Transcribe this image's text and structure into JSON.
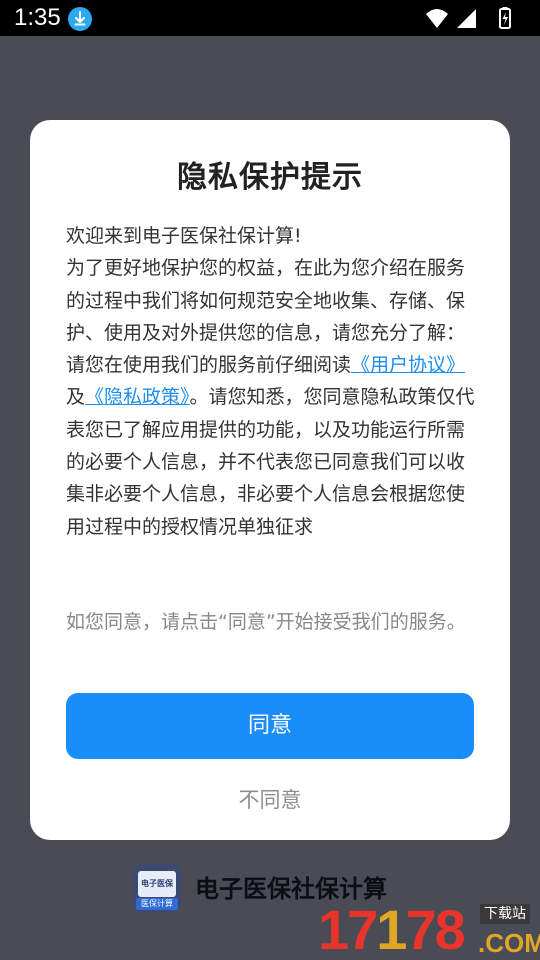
{
  "status_bar": {
    "time": "1:35",
    "icons": [
      "download-icon",
      "wifi-icon",
      "signal-icon",
      "battery-icon"
    ]
  },
  "dialog": {
    "title": "隐私保护提示",
    "welcome": "欢迎来到电子医保社保计算!",
    "intro": "为了更好地保护您的权益，在此为您介绍在服务的过程中我们将如何规范安全地收集、存储、保护、使用及对外提供您的信息，请您充分了解：",
    "read_prefix": "请您在使用我们的服务前仔细阅读",
    "user_agreement_link": "《用户协议》",
    "and_text": "及",
    "privacy_policy_link": "《隐私政策》",
    "read_suffix": "。请您知悉，您同意隐私政策仅代表您已了解应用提供的功能，以及功能运行所需的必要个人信息，并不代表您已同意我们可以收集非必要个人信息，非必要个人信息会根据您使用过程中的授权情况单独征求",
    "hint": "如您同意，请点击“同意”开始接受我们的服务。",
    "agree_label": "同意",
    "disagree_label": "不同意"
  },
  "app": {
    "name": "电子医保社保计算",
    "logo_top_text": "电子医保",
    "logo_bottom_text": "医保计算"
  },
  "watermark": {
    "number_red_1": "17",
    "number_gold": "1",
    "number_red_2": "78",
    "tag": "下载站",
    "domain": ".COM"
  },
  "colors": {
    "accent": "#1a8ef8",
    "link": "#1d8ef0",
    "backdrop": "#4a4c55"
  }
}
